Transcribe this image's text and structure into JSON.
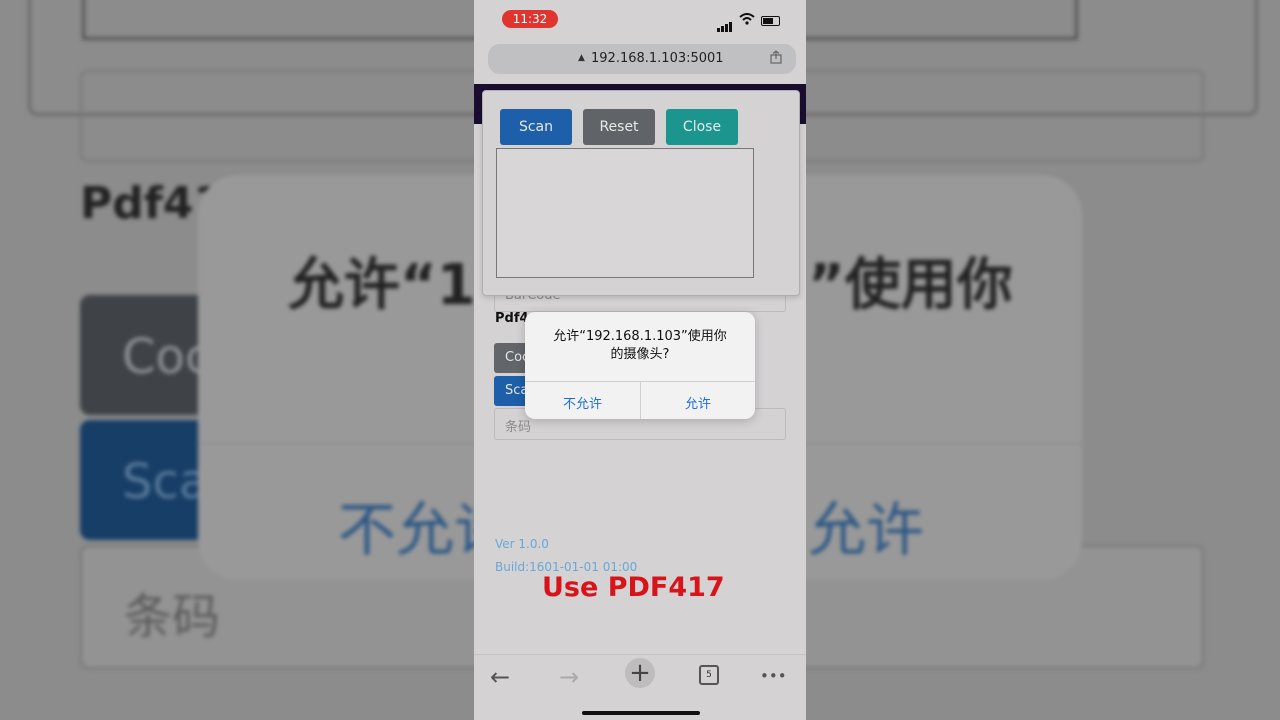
{
  "background": {
    "barcode_text": "BarCode",
    "pdf_label": "Pdf41",
    "code_button": "Coc",
    "scan_button": "Sca",
    "barcode_placeholder": "条码",
    "dialog_title_left": "允许“19",
    "dialog_title_right": "”使用你",
    "deny": "不允许",
    "allow": "允许"
  },
  "status_bar": {
    "time": "11:32",
    "wifi_icon": "wifi-icon",
    "battery_icon": "battery-icon"
  },
  "address_bar": {
    "url": "192.168.1.103:5001",
    "lock_icon": "▲",
    "share_icon": "share-icon"
  },
  "scanner_panel": {
    "scan": "Scan",
    "reset": "Reset",
    "close": "Close"
  },
  "page": {
    "barcode_field": "BarCode",
    "pdf_label": "Pdf4",
    "code_button": "Coc",
    "scan_button": "Sca",
    "barcode_placeholder": "条码",
    "version": "Ver 1.0.0",
    "build": "Build:1601-01-01 01:00",
    "caption": "Use PDF417"
  },
  "alert": {
    "title_line1": "允许“192.168.1.103”使用你",
    "title_line2": "的摄像头?",
    "deny": "不允许",
    "allow": "允许"
  },
  "toolbar": {
    "back": "←",
    "forward": "→",
    "new_tab": "+",
    "tab_count": "5",
    "more": "•••"
  }
}
